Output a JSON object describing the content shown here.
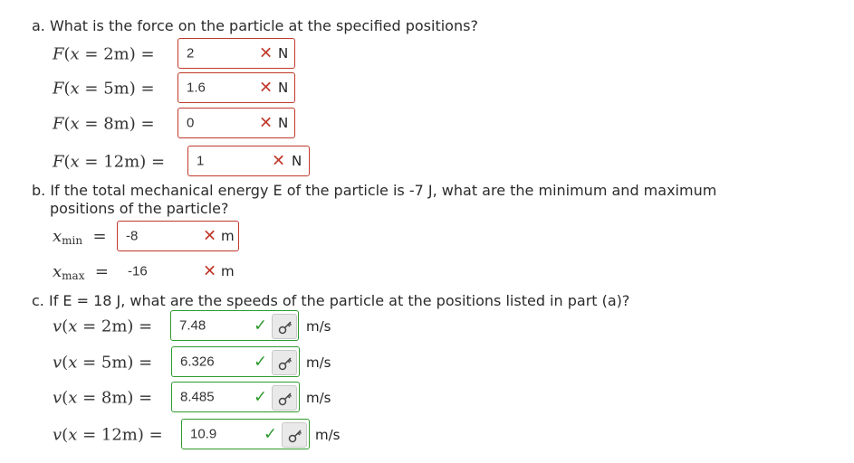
{
  "part_a": {
    "question": "a. What is the force on the particle at the specified positions?",
    "rows": [
      {
        "lhs": "2m",
        "value": "2",
        "status": "wrong",
        "unit": "N"
      },
      {
        "lhs": "5m",
        "value": "1.6",
        "status": "wrong",
        "unit": "N"
      },
      {
        "lhs": "8m",
        "value": "0",
        "status": "wrong",
        "unit": "N"
      },
      {
        "lhs": "12m",
        "value": "1",
        "status": "wrong",
        "unit": "N"
      }
    ]
  },
  "part_b": {
    "question_line1": "b. If the total mechanical energy E of the particle is -7 J, what are the minimum and maximum",
    "question_line2": "positions of the particle?",
    "xmin": {
      "sub": "min",
      "value": "-8",
      "status": "wrong",
      "unit": "m"
    },
    "xmax": {
      "sub": "max",
      "value": "-16",
      "status": "wrong",
      "unit": "m"
    }
  },
  "part_c": {
    "question": "c. If E = 18 J, what are the speeds of the particle at the positions listed in part (a)?",
    "rows": [
      {
        "lhs": "2m",
        "value": "7.48",
        "status": "correct",
        "unit": "m/s"
      },
      {
        "lhs": "5m",
        "value": "6.326",
        "status": "correct",
        "unit": "m/s"
      },
      {
        "lhs": "8m",
        "value": "8.485",
        "status": "correct",
        "unit": "m/s"
      },
      {
        "lhs": "12m",
        "value": "10.9",
        "status": "correct",
        "unit": "m/s"
      }
    ]
  },
  "icons": {
    "wrong": "✕",
    "correct": "✓",
    "key": "key-icon"
  },
  "colors": {
    "wrong": "#c0392b",
    "correct": "#2e9a2e"
  }
}
